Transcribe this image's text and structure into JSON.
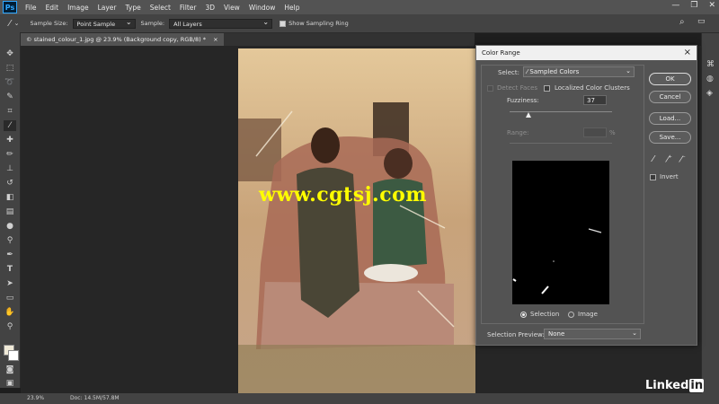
{
  "menubar": {
    "logo": "Ps",
    "items": [
      "File",
      "Edit",
      "Image",
      "Layer",
      "Type",
      "Select",
      "Filter",
      "3D",
      "View",
      "Window",
      "Help"
    ]
  },
  "options": {
    "sample_size_label": "Sample Size:",
    "sample_size_value": "Point Sample",
    "sample_label": "Sample:",
    "sample_value": "All Layers",
    "show_ring_label": "Show Sampling Ring"
  },
  "document": {
    "tab_title": "© stained_colour_1.jpg @ 23.9% (Background copy, RGB/8) *",
    "tab_close": "×"
  },
  "status": {
    "zoom": "23.9%",
    "doc_info": "Doc: 14.5M/57.8M"
  },
  "watermark": "www.cgtsj.com",
  "brand": "Linked",
  "brand_in": "in",
  "dialog": {
    "title": "Color Range",
    "close": "×",
    "select_label": "Select:",
    "select_value": "Sampled Colors",
    "detect_faces": "Detect Faces",
    "localized_clusters": "Localized Color Clusters",
    "fuzziness_label": "Fuzziness:",
    "fuzziness_value": "37",
    "fuzziness_max": 200,
    "range_label": "Range:",
    "range_unit": "%",
    "selection_label": "Selection",
    "image_label": "Image",
    "preview_label": "Selection Preview:",
    "preview_value": "None",
    "buttons": {
      "ok": "OK",
      "cancel": "Cancel",
      "load": "Load...",
      "save": "Save..."
    },
    "invert_label": "Invert"
  },
  "colors": {
    "accent_yellow": "#ffff00",
    "ps_blue": "#31a8ff",
    "linkedin_blue": "#0a66c2"
  }
}
